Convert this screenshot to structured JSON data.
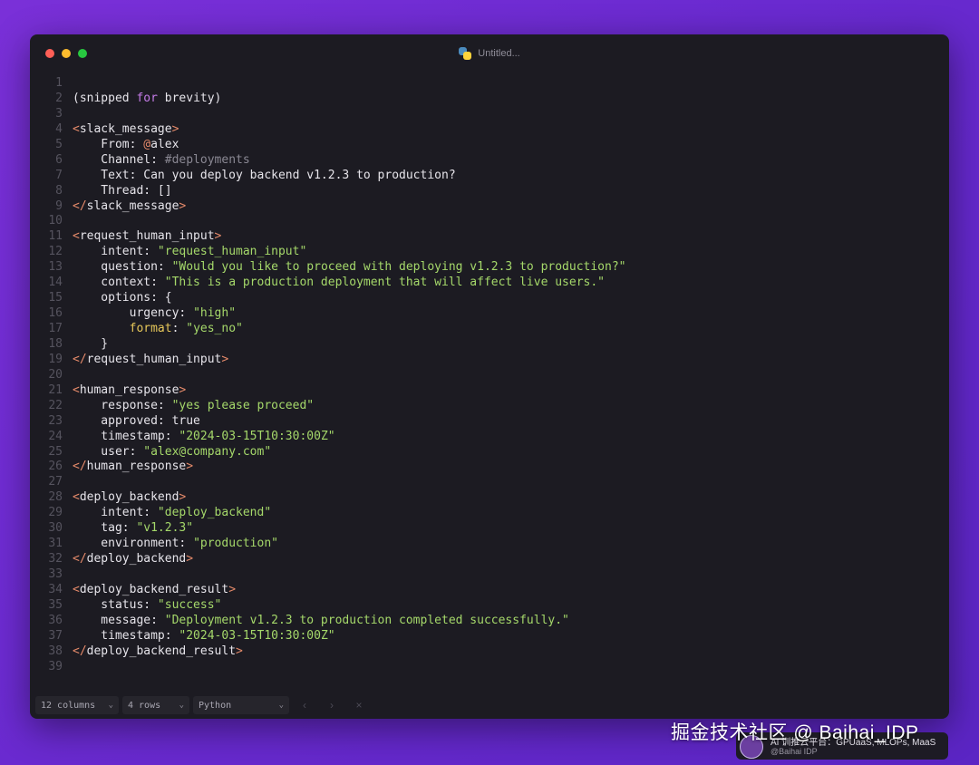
{
  "window": {
    "title": "Untitled..."
  },
  "lines": [
    [],
    [
      [
        "t",
        "(snipped "
      ],
      [
        "kw",
        "for"
      ],
      [
        "t",
        " brevity)"
      ]
    ],
    [],
    [
      [
        "br",
        "<"
      ],
      [
        "t",
        "slack_message"
      ],
      [
        "br",
        ">"
      ]
    ],
    [
      [
        "t",
        "    From: "
      ],
      [
        "at",
        "@"
      ],
      [
        "t",
        "alex"
      ]
    ],
    [
      [
        "t",
        "    Channel: "
      ],
      [
        "cmt",
        "#deployments"
      ]
    ],
    [
      [
        "t",
        "    Text: Can you deploy backend v1.2.3 to production?"
      ]
    ],
    [
      [
        "t",
        "    Thread: []"
      ]
    ],
    [
      [
        "br",
        "</"
      ],
      [
        "t",
        "slack_message"
      ],
      [
        "br",
        ">"
      ]
    ],
    [],
    [
      [
        "br",
        "<"
      ],
      [
        "t",
        "request_human_input"
      ],
      [
        "br",
        ">"
      ]
    ],
    [
      [
        "t",
        "    intent: "
      ],
      [
        "str",
        "\"request_human_input\""
      ]
    ],
    [
      [
        "t",
        "    question: "
      ],
      [
        "str",
        "\"Would you like to proceed with deploying v1.2.3 to production?\""
      ]
    ],
    [
      [
        "t",
        "    context: "
      ],
      [
        "str",
        "\"This is a production deployment that will affect live users.\""
      ]
    ],
    [
      [
        "t",
        "    options: {"
      ]
    ],
    [
      [
        "t",
        "        urgency: "
      ],
      [
        "str",
        "\"high\""
      ]
    ],
    [
      [
        "t",
        "        "
      ],
      [
        "ykey",
        "format"
      ],
      [
        "t",
        ": "
      ],
      [
        "str",
        "\"yes_no\""
      ]
    ],
    [
      [
        "t",
        "    }"
      ]
    ],
    [
      [
        "br",
        "</"
      ],
      [
        "t",
        "request_human_input"
      ],
      [
        "br",
        ">"
      ]
    ],
    [],
    [
      [
        "br",
        "<"
      ],
      [
        "t",
        "human_response"
      ],
      [
        "br",
        ">"
      ]
    ],
    [
      [
        "t",
        "    response: "
      ],
      [
        "str",
        "\"yes please proceed\""
      ]
    ],
    [
      [
        "t",
        "    approved: true"
      ]
    ],
    [
      [
        "t",
        "    timestamp: "
      ],
      [
        "str",
        "\"2024-03-15T10:30:00Z\""
      ]
    ],
    [
      [
        "t",
        "    user: "
      ],
      [
        "str",
        "\"alex@company.com\""
      ]
    ],
    [
      [
        "br",
        "</"
      ],
      [
        "t",
        "human_response"
      ],
      [
        "br",
        ">"
      ]
    ],
    [],
    [
      [
        "br",
        "<"
      ],
      [
        "t",
        "deploy_backend"
      ],
      [
        "br",
        ">"
      ]
    ],
    [
      [
        "t",
        "    intent: "
      ],
      [
        "str",
        "\"deploy_backend\""
      ]
    ],
    [
      [
        "t",
        "    tag: "
      ],
      [
        "str",
        "\"v1.2.3\""
      ]
    ],
    [
      [
        "t",
        "    environment: "
      ],
      [
        "str",
        "\"production\""
      ]
    ],
    [
      [
        "br",
        "</"
      ],
      [
        "t",
        "deploy_backend"
      ],
      [
        "br",
        ">"
      ]
    ],
    [],
    [
      [
        "br",
        "<"
      ],
      [
        "t",
        "deploy_backend_result"
      ],
      [
        "br",
        ">"
      ]
    ],
    [
      [
        "t",
        "    status: "
      ],
      [
        "str",
        "\"success\""
      ]
    ],
    [
      [
        "t",
        "    message: "
      ],
      [
        "str",
        "\"Deployment v1.2.3 to production completed successfully.\""
      ]
    ],
    [
      [
        "t",
        "    timestamp: "
      ],
      [
        "str",
        "\"2024-03-15T10:30:00Z\""
      ]
    ],
    [
      [
        "br",
        "</"
      ],
      [
        "t",
        "deploy_backend_result"
      ],
      [
        "br",
        ">"
      ]
    ],
    []
  ],
  "statusbar": {
    "columns": "12 columns",
    "rows": "4 rows",
    "language": "Python",
    "prev": "‹",
    "next": "›",
    "close": "×"
  },
  "watermark": {
    "text": "掘金技术社区 @ Baihai_IDP",
    "badge_line1": "AI 训推云平台：GPUaaS, MLOPs, MaaS",
    "badge_line2": "@Baihai IDP"
  }
}
